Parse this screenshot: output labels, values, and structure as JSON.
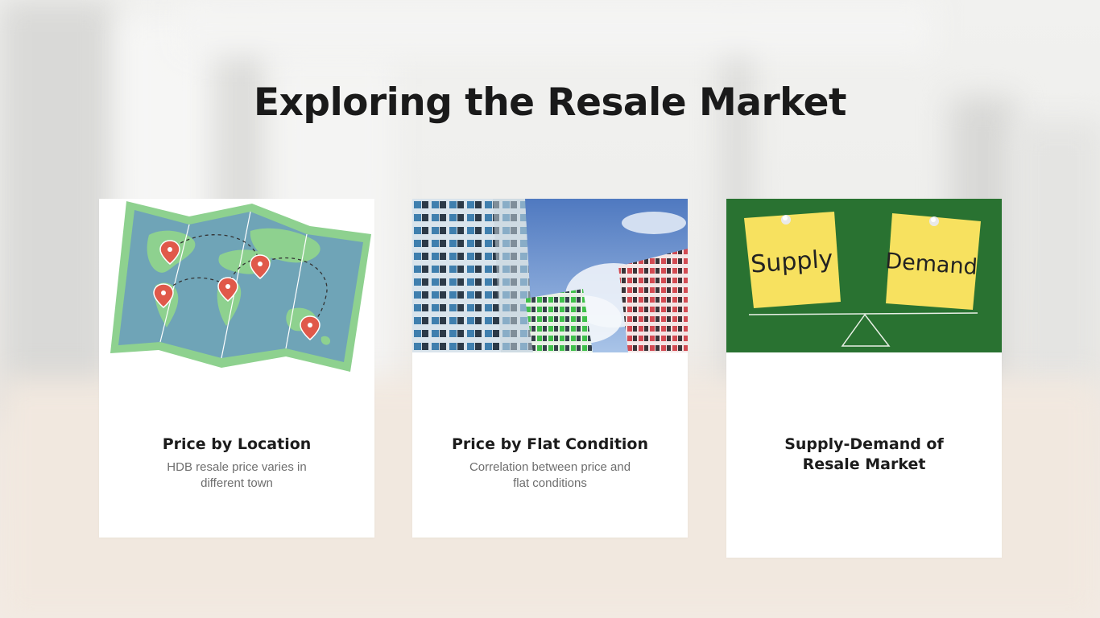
{
  "slide": {
    "title": "Exploring the Resale Market"
  },
  "cards": [
    {
      "title": "Price by Location",
      "description": "HDB resale price varies in different town",
      "image": "world-map-icon"
    },
    {
      "title": "Price by Flat Condition",
      "description": "Correlation between price and flat conditions",
      "image": "hdb-flats-photo"
    },
    {
      "title": "Supply-Demand of Resale Market",
      "image": "supply-demand-chalkboard",
      "notes": [
        "Supply",
        "Demand"
      ]
    }
  ],
  "colors": {
    "map_land": "#8ed18f",
    "map_sea": "#6fa4b7",
    "pin": "#e0594a",
    "chalkboard": "#2d7a34",
    "sticky_note": "#f7e15f"
  }
}
